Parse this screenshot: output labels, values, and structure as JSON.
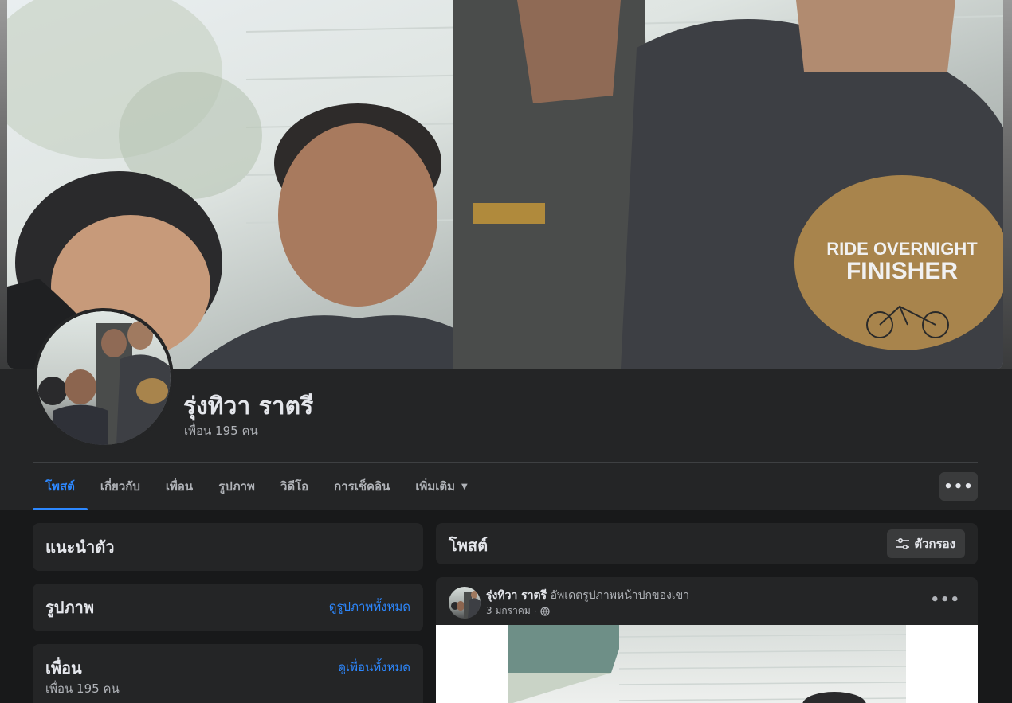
{
  "profile": {
    "name": "รุ่งทิวา ราตรี",
    "friends_text": "เพื่อน 195 คน"
  },
  "nav": {
    "tabs": [
      {
        "label": "โพสต์",
        "active": true
      },
      {
        "label": "เกี่ยวกับ"
      },
      {
        "label": "เพื่อน"
      },
      {
        "label": "รูปภาพ"
      },
      {
        "label": "วิดีโอ"
      },
      {
        "label": "การเช็คอิน"
      },
      {
        "label": "เพิ่มเติม",
        "dropdown": true
      }
    ],
    "more_icon": "ellipsis-icon"
  },
  "sidebar": {
    "intro": {
      "title": "แนะนำตัว"
    },
    "photos": {
      "title": "รูปภาพ",
      "link": "ดูรูปภาพทั้งหมด"
    },
    "friends": {
      "title": "เพื่อน",
      "link": "ดูเพื่อนทั้งหมด",
      "count_text": "เพื่อน 195 คน"
    }
  },
  "feed": {
    "header_title": "โพสต์",
    "filter_label": "ตัวกรอง",
    "post": {
      "author": "รุ่งทิวา ราตรี",
      "action": "อัพเดตรูปภาพหน้าปกของเขา",
      "date": "3 มกราคม",
      "separator": "·",
      "privacy_icon": "globe-icon"
    }
  },
  "cover_print": {
    "line1": "RIDE OVERNIGHT",
    "line2": "FINISHER"
  },
  "colors": {
    "background": "#18191a",
    "card": "#242526",
    "accent": "#2d88ff",
    "text_primary": "#e4e6eb",
    "text_secondary": "#b0b3b8"
  }
}
